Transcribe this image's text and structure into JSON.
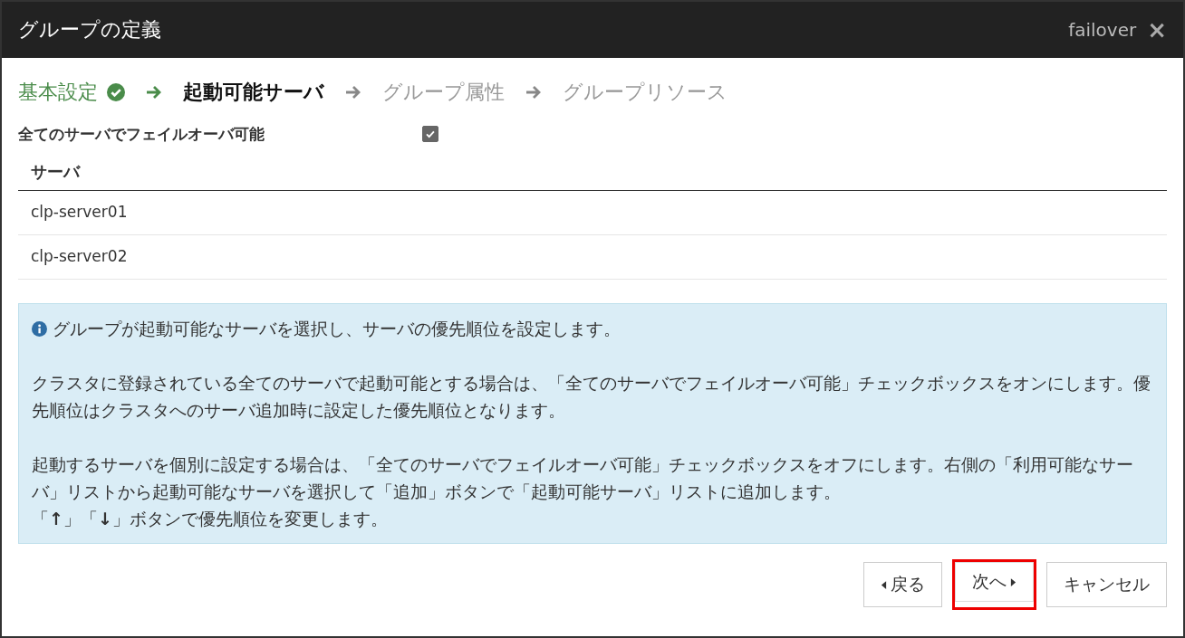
{
  "window": {
    "title": "グループの定義",
    "context": "failover",
    "close": "×"
  },
  "steps": [
    {
      "label": "基本設定",
      "kind": "done"
    },
    {
      "label": "起動可能サーバ",
      "kind": "current"
    },
    {
      "label": "グループ属性",
      "kind": "pending"
    },
    {
      "label": "グループリソース",
      "kind": "pending"
    }
  ],
  "failover_all": {
    "label": "全てのサーバでフェイルオーバ可能",
    "checked": true
  },
  "table": {
    "columns": [
      "サーバ"
    ],
    "rows": [
      [
        "clp-server01"
      ],
      [
        "clp-server02"
      ]
    ]
  },
  "info": {
    "paragraphs": [
      [
        "グループが起動可能なサーバを選択し、サーバの優先順位を設定します。"
      ],
      [
        "クラスタに登録されている全てのサーバで起動可能とする場合は、「全てのサーバでフェイルオーバ可能」チェックボックスをオンにします。優先順位はクラスタへのサーバ追加時に設定した優先順位となります。"
      ],
      [
        "起動するサーバを個別に設定する場合は、「全てのサーバでフェイルオーバ可能」チェックボックスをオフにします。右側の「利用可能なサーバ」リストから起動可能なサーバを選択して「追加」ボタンで「起動可能サーバ」リストに追加します。",
        "「**↑**」「**↓**」ボタンで優先順位を変更します。"
      ]
    ]
  },
  "buttons": [
    {
      "label": "戻る",
      "kind": "back",
      "highlighted": false
    },
    {
      "label": "次へ",
      "kind": "next",
      "highlighted": true
    },
    {
      "label": "キャンセル",
      "kind": "cancel",
      "highlighted": false
    }
  ]
}
